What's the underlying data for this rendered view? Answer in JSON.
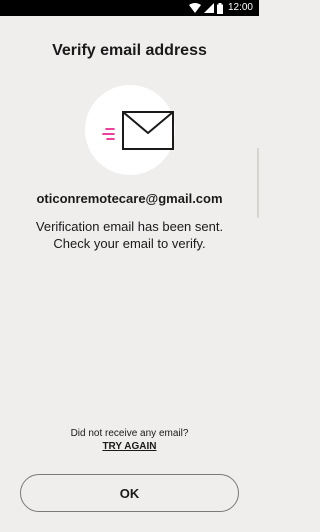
{
  "status_bar": {
    "time": "12:00",
    "icons": [
      "wifi-icon",
      "signal-icon",
      "battery-icon"
    ]
  },
  "header": {
    "title": "Verify email address"
  },
  "illustration": {
    "icon": "envelope-icon",
    "accent_color": "#e5007d"
  },
  "content": {
    "email": "oticonremotecare@gmail.com",
    "message_line1": "Verification email has been sent.",
    "message_line2": "Check your email to verify."
  },
  "footer": {
    "no_email_text": "Did not receive any email?",
    "try_again_label": "TRY AGAIN",
    "ok_label": "OK"
  }
}
